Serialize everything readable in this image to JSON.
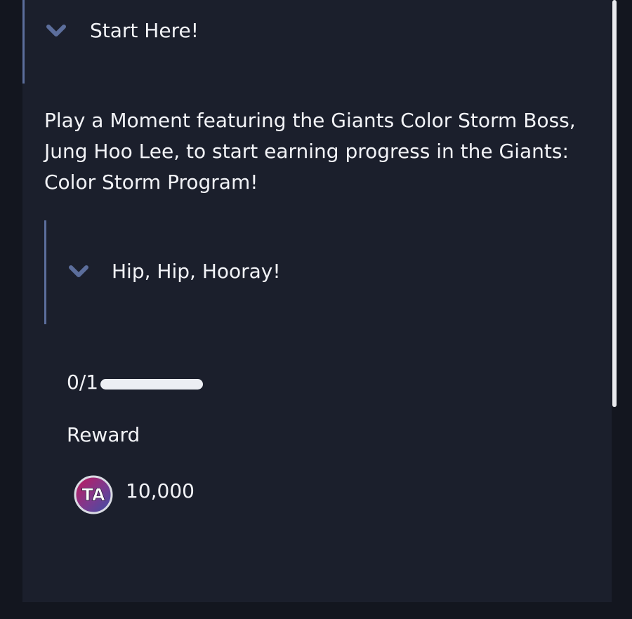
{
  "section": {
    "title": "Start Here!",
    "expanded": true,
    "description": "Play a Moment featuring the Giants Color Storm Boss, Jung Hoo Lee, to start earning progress in the Giants: Color Storm Program!"
  },
  "task": {
    "title": "Hip, Hip, Hooray!",
    "expanded": true,
    "progress_text": "0/1",
    "progress_fraction": 0,
    "reward_heading": "Reward",
    "reward": {
      "icon": "ta-coin-icon",
      "amount": "10,000"
    }
  },
  "colors": {
    "background": "#13161f",
    "panel": "#1b1f2c",
    "accent": "#5c6e9c",
    "text": "#f2f3f7"
  }
}
